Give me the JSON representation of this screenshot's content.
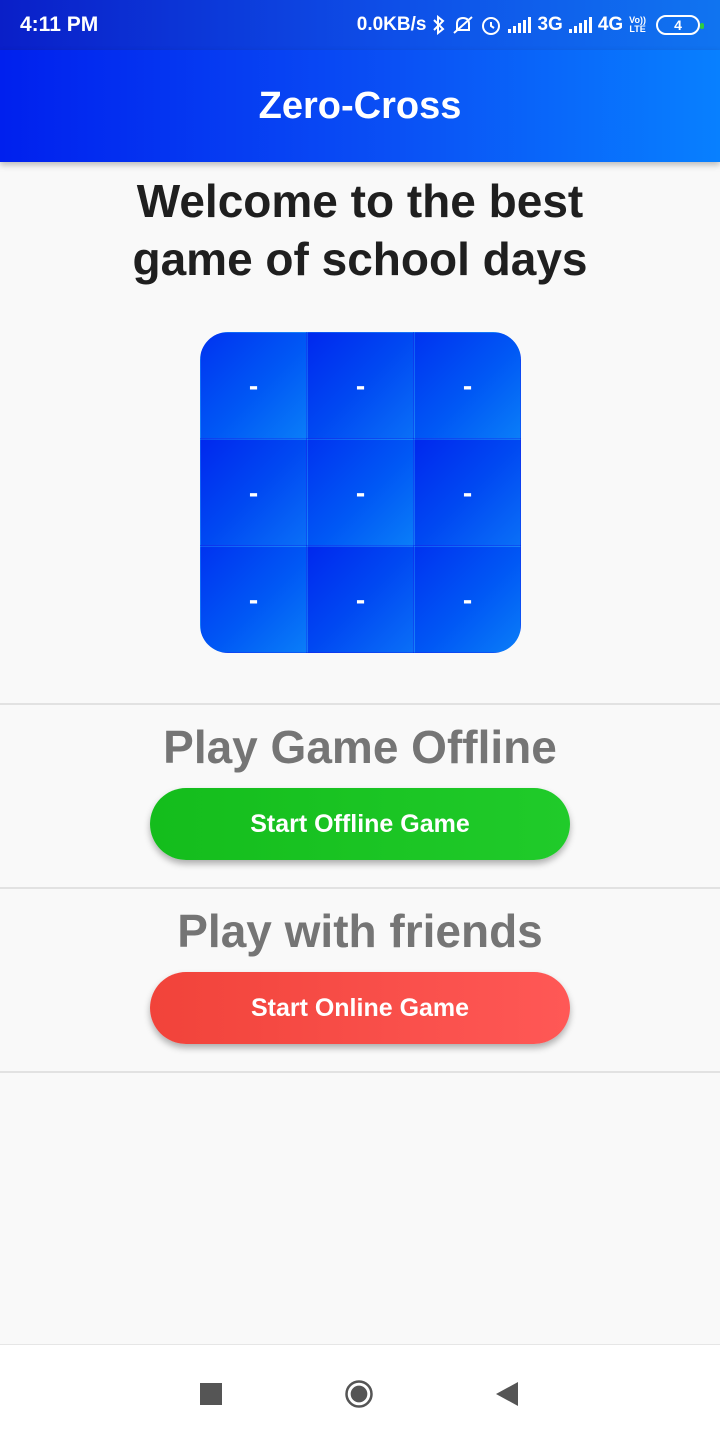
{
  "status_bar": {
    "time": "4:11 PM",
    "network_speed": "0.0KB/s",
    "net1": "3G",
    "net2": "4G",
    "volte_top": "Vo))",
    "volte_bottom": "LTE",
    "battery": "4",
    "icons": [
      "bluetooth-icon",
      "mute-icon",
      "alarm-icon",
      "signal-icon",
      "signal-icon",
      "battery-icon"
    ]
  },
  "app_bar": {
    "title": "Zero-Cross"
  },
  "welcome": {
    "line1": "Welcome to the best",
    "line2": "game of school days"
  },
  "board": {
    "cells": [
      "-",
      "-",
      "-",
      "-",
      "-",
      "-",
      "-",
      "-",
      "-"
    ],
    "colors": {
      "primary": "#0033f0",
      "secondary": "#0a7df8"
    }
  },
  "offline_section": {
    "title": "Play Game Offline",
    "button_label": "Start Offline Game",
    "button_color": "#1cc424"
  },
  "online_section": {
    "title": "Play with friends",
    "button_label": "Start Online Game",
    "button_color": "#f44a46"
  },
  "nav_bar": {
    "icons": [
      "recents-icon",
      "home-icon",
      "back-icon"
    ]
  }
}
